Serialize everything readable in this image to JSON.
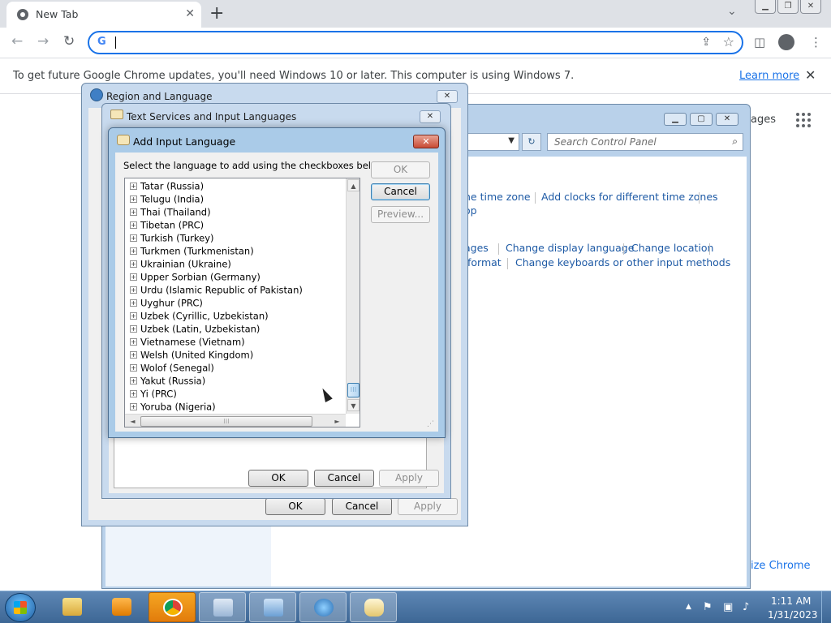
{
  "chrome": {
    "tab_title": "New Tab",
    "tab_close": "✕",
    "new_tab": "+",
    "tab_search": "⌄",
    "omnibox_logo": "G",
    "omnibox_value": "",
    "infobar_message": "To get future Google Chrome updates, you'll need Windows 10 or later. This computer is using Windows 7.",
    "infobar_link": "Learn more",
    "infobar_close": "✕",
    "ntp_right_text": "ages",
    "customize_text": "ize Chrome",
    "nav": {
      "back": "←",
      "forward": "→",
      "reload": "↻"
    },
    "icons": {
      "share": "⇪",
      "star": "☆",
      "sidepanel": "◫",
      "menu": "⋮"
    }
  },
  "control_panel": {
    "search_placeholder": "Search Control Panel",
    "search_icon": "⌕",
    "refresh_icon": "↻",
    "links": {
      "time_zone": "he time zone",
      "add_clocks": "Add clocks for different time zones",
      "op": "op",
      "ages": "ages",
      "change_display_language": "Change display language",
      "change_location": "Change location",
      "format": "format",
      "change_keyboards": "Change keyboards or other input methods"
    }
  },
  "region_language": {
    "title": "Region and Language",
    "close": "✕",
    "buttons": {
      "ok": "OK",
      "cancel": "Cancel",
      "apply": "Apply"
    }
  },
  "text_services": {
    "title": "Text Services and Input Languages",
    "close": "✕",
    "buttons": {
      "ok": "OK",
      "cancel": "Cancel",
      "apply": "Apply"
    }
  },
  "add_input_language": {
    "title": "Add Input Language",
    "close": "✕",
    "instruction": "Select the language to add using the checkboxes below.",
    "buttons": {
      "ok": "OK",
      "cancel": "Cancel",
      "preview": "Preview..."
    },
    "languages": [
      "Tatar (Russia)",
      "Telugu (India)",
      "Thai (Thailand)",
      "Tibetan (PRC)",
      "Turkish (Turkey)",
      "Turkmen (Turkmenistan)",
      "Ukrainian (Ukraine)",
      "Upper Sorbian (Germany)",
      "Urdu (Islamic Republic of Pakistan)",
      "Uyghur (PRC)",
      "Uzbek (Cyrillic, Uzbekistan)",
      "Uzbek (Latin, Uzbekistan)",
      "Vietnamese (Vietnam)",
      "Welsh (United Kingdom)",
      "Wolof (Senegal)",
      "Yakut (Russia)",
      "Yi (PRC)",
      "Yoruba (Nigeria)"
    ],
    "expander": "+",
    "scroll": {
      "up": "▲",
      "down": "▼",
      "left": "◄",
      "right": "►",
      "grip": "⁝⁝⁝"
    }
  },
  "taskbar": {
    "time": "1:11 AM",
    "date": "1/31/2023",
    "tray": {
      "up": "▲",
      "flag": "⚑",
      "network": "▣",
      "volume": "♪"
    }
  },
  "colors": {
    "accent": "#1a73e8",
    "link": "#1e5aa5",
    "taskbar": "#3d6795"
  }
}
